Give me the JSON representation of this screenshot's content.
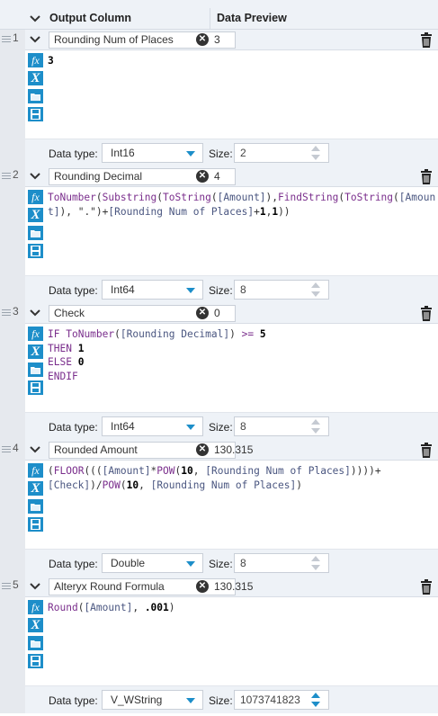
{
  "header": {
    "col1": "Output Column",
    "col2": "Data Preview"
  },
  "labels": {
    "data_type": "Data type:",
    "size": "Size:"
  },
  "rows": [
    {
      "num": "1",
      "name": "Rounding Num of Places",
      "preview": "3",
      "data_type": "Int16",
      "size": "2",
      "code": "<span class=\"num\">3</span>"
    },
    {
      "num": "2",
      "name": "Rounding Decimal",
      "preview": "4",
      "data_type": "Int64",
      "size": "8",
      "code": "<span class=\"fn\">ToNumber</span>(<span class=\"fn\">Substring</span>(<span class=\"fn\">ToString</span>(<span class=\"fld\">[Amount]</span>),<span class=\"fn\">FindString</span>(<span class=\"fn\">ToString</span>(<span class=\"fld\">[Amount]</span>), <span class=\"str\">\".\"</span>)+<span class=\"fld\">[Rounding Num of Places]</span>+<span class=\"num\">1</span>,<span class=\"num\">1</span>))"
    },
    {
      "num": "3",
      "name": "Check",
      "preview": "0",
      "data_type": "Int64",
      "size": "8",
      "code": "<span class=\"kw\">IF</span> <span class=\"fn\">ToNumber</span>(<span class=\"fld\">[Rounding Decimal]</span>) <span class=\"kw\">&gt;=</span> <span class=\"num\">5</span>\n<span class=\"kw\">THEN</span> <span class=\"num\">1</span>\n<span class=\"kw\">ELSE</span> <span class=\"num\">0</span>\n<span class=\"kw\">ENDIF</span>"
    },
    {
      "num": "4",
      "name": "Rounded Amount",
      "preview": "130.315",
      "data_type": "Double",
      "size": "8",
      "code": "(<span class=\"fn\">FLOOR</span>(((<span class=\"fld\">[Amount]</span>*<span class=\"fn\">POW</span>(<span class=\"num\">10</span>, <span class=\"fld\">[Rounding Num of Places]</span>))))+\n<span class=\"fld\">[Check]</span>)/<span class=\"fn\">POW</span>(<span class=\"num\">10</span>, <span class=\"fld\">[Rounding Num of Places]</span>)"
    },
    {
      "num": "5",
      "name": "Alteryx Round Formula",
      "preview": "130.315",
      "data_type": "V_WString",
      "size": "1073741823",
      "code": "<span class=\"fn\">Round</span>(<span class=\"fld\">[Amount]</span>, <span class=\"num\">.001</span>)"
    }
  ],
  "colors": {
    "accent": "#1d8ec9",
    "header_bg": "#eef2f7",
    "gutter_bg": "#e6e9ee"
  }
}
